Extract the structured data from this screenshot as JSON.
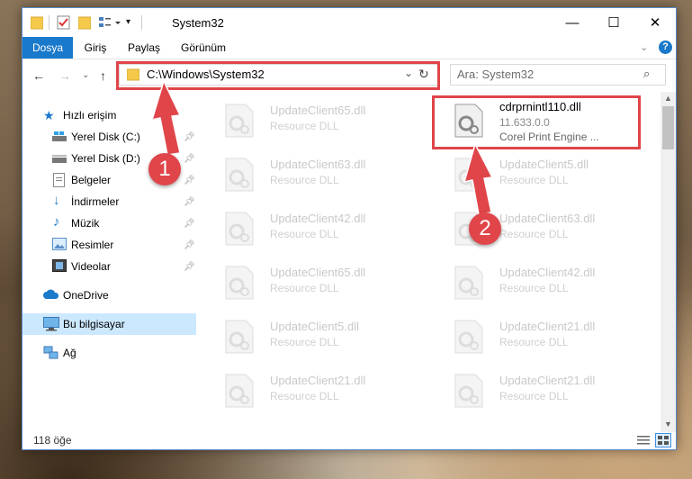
{
  "window": {
    "title": "System32",
    "controls": {
      "minimize": "—",
      "maximize": "☐",
      "close": "✕"
    }
  },
  "ribbon": {
    "tabs": [
      "Dosya",
      "Giriş",
      "Paylaş",
      "Görünüm"
    ],
    "expand_icon": "chevron-down-icon",
    "help_icon": "help-icon"
  },
  "nav": {
    "address": "C:\\Windows\\System32",
    "search_placeholder": "Ara: System32"
  },
  "sidebar": {
    "items": [
      {
        "label": "Hızlı erişim",
        "icon": "star-icon"
      },
      {
        "label": "Yerel Disk (C:)",
        "icon": "drive-icon",
        "pinned": true
      },
      {
        "label": "Yerel Disk (D:)",
        "icon": "drive-icon",
        "pinned": true
      },
      {
        "label": "Belgeler",
        "icon": "documents-icon",
        "pinned": true
      },
      {
        "label": "İndirmeler",
        "icon": "download-icon",
        "pinned": true
      },
      {
        "label": "Müzik",
        "icon": "music-icon",
        "pinned": true
      },
      {
        "label": "Resimler",
        "icon": "pictures-icon",
        "pinned": true
      },
      {
        "label": "Videolar",
        "icon": "videos-icon",
        "pinned": true
      },
      {
        "label": "OneDrive",
        "icon": "cloud-icon"
      },
      {
        "label": "Bu bilgisayar",
        "icon": "computer-icon",
        "selected": true
      },
      {
        "label": "Ağ",
        "icon": "network-icon"
      }
    ]
  },
  "files": {
    "left": [
      {
        "name": "UpdateClient65.dll",
        "desc": "Resource DLL"
      },
      {
        "name": "UpdateClient63.dll",
        "desc": "Resource DLL"
      },
      {
        "name": "UpdateClient42.dll",
        "desc": "Resource DLL"
      },
      {
        "name": "UpdateClient65.dll",
        "desc": "Resource DLL"
      },
      {
        "name": "UpdateClient5.dll",
        "desc": "Resource DLL"
      },
      {
        "name": "UpdateClient21.dll",
        "desc": "Resource DLL"
      }
    ],
    "right": [
      {
        "name": "cdrprnintl110.dll",
        "desc": "11.633.0.0",
        "desc2": "Corel Print Engine ...",
        "highlighted": true
      },
      {
        "name": "UpdateClient5.dll",
        "desc": "Resource DLL"
      },
      {
        "name": "UpdateClient63.dll",
        "desc": "Resource DLL"
      },
      {
        "name": "UpdateClient42.dll",
        "desc": "Resource DLL"
      },
      {
        "name": "UpdateClient21.dll",
        "desc": "Resource DLL"
      },
      {
        "name": "UpdateClient21.dll",
        "desc": "Resource DLL"
      }
    ]
  },
  "status": {
    "count": "118 öğe"
  },
  "annotations": [
    {
      "number": "1"
    },
    {
      "number": "2"
    }
  ],
  "colors": {
    "accent": "#1979ca",
    "annotation": "#e0454a",
    "selected_bg": "#cce8ff"
  }
}
